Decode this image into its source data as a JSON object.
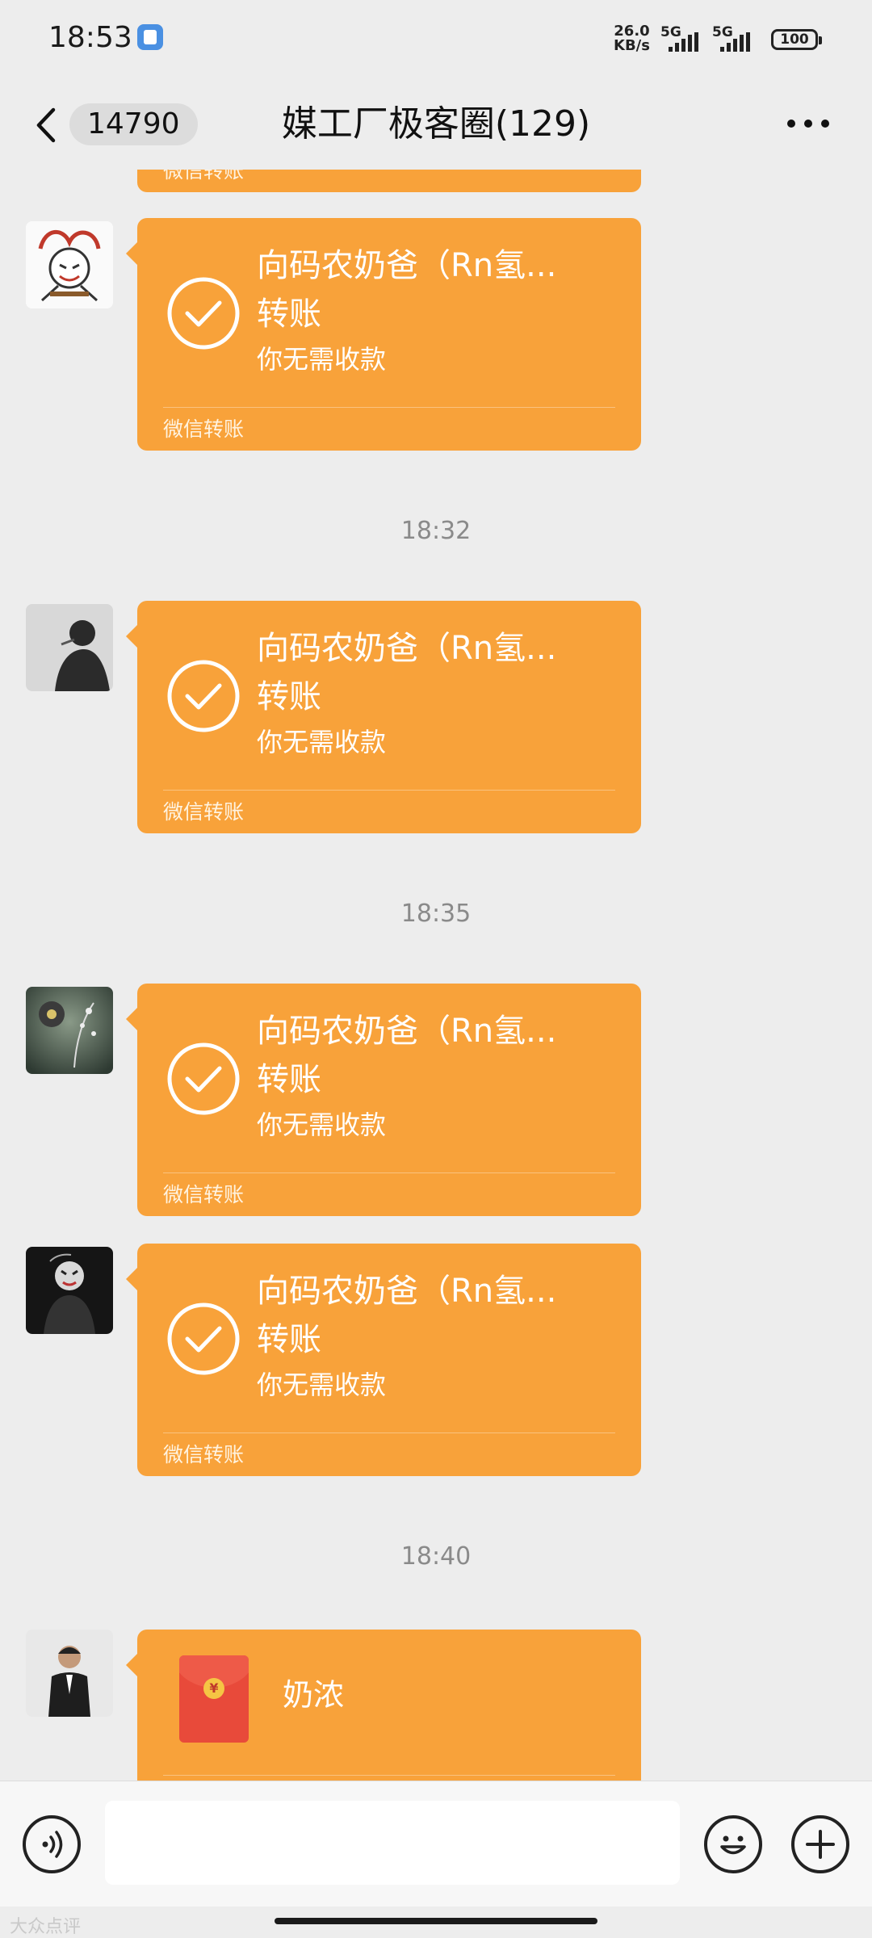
{
  "status_bar": {
    "time": "18:53",
    "net_speed_value": "26.0",
    "net_speed_unit": "KB/s",
    "sim1": "5G",
    "sim2": "5G",
    "battery": "100"
  },
  "nav": {
    "unread_count": "14790",
    "title": "媒工厂极客圈(129)"
  },
  "transfer_texts": {
    "name": "向码农奶爸（Rn氢...",
    "kind": "转账",
    "note": "你无需收款",
    "source": "微信转账"
  },
  "messages": [
    {
      "type": "transfer",
      "avatar": "jester-avatar-icon"
    },
    {
      "type": "time",
      "text": "18:32"
    },
    {
      "type": "transfer",
      "avatar": "man-smoking-avatar-icon"
    },
    {
      "type": "time",
      "text": "18:35"
    },
    {
      "type": "transfer",
      "avatar": "flower-art-avatar-icon"
    },
    {
      "type": "transfer",
      "avatar": "joker-avatar-icon"
    },
    {
      "type": "time",
      "text": "18:40"
    },
    {
      "type": "red_packet",
      "avatar": "man-in-suit-avatar-icon",
      "title": "奶浓"
    }
  ],
  "input_bar": {
    "voice_icon": "voice-icon",
    "emoji_icon": "emoji-icon",
    "plus_icon": "plus-icon",
    "input_value": ""
  },
  "watermark": "大众点评",
  "colors": {
    "background": "#ededed",
    "transfer_card": "#f8a23a",
    "red_envelope": "#e84a3a",
    "timestamp": "#8a8a8a"
  }
}
